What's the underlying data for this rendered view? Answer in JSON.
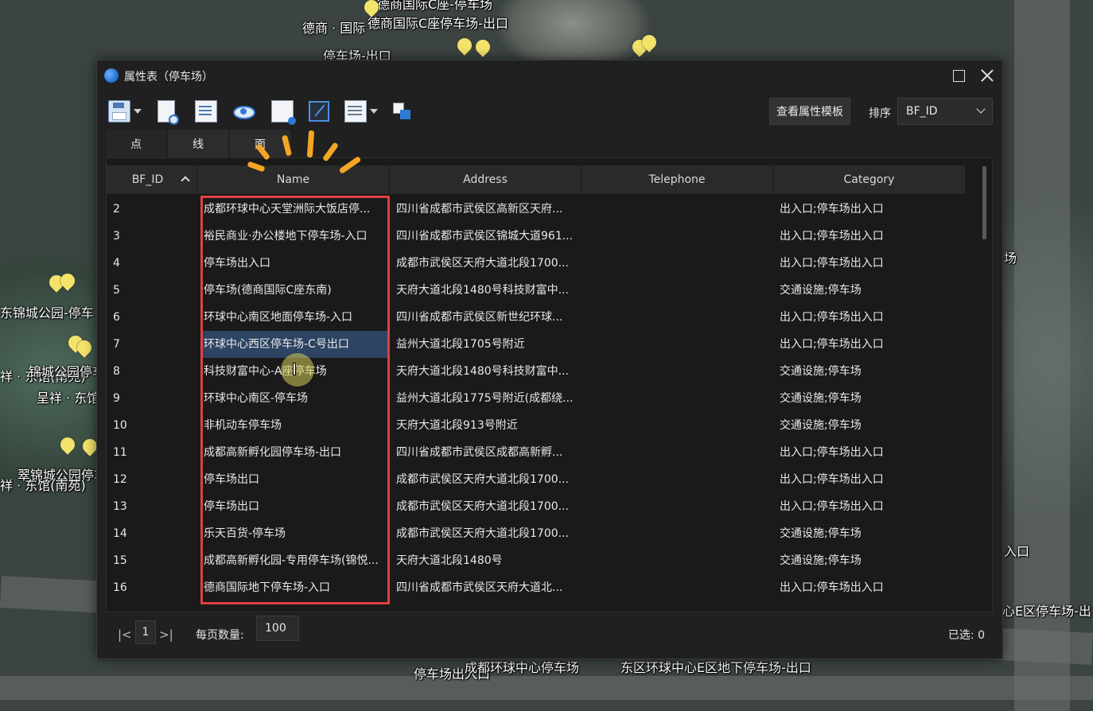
{
  "window": {
    "title": "属性表（停车场）"
  },
  "toolbar": {
    "view_template_label": "查看属性模板",
    "sort_label": "排序",
    "sort_value": "BF_ID"
  },
  "tabs": [
    {
      "label": "点"
    },
    {
      "label": "线"
    },
    {
      "label": "面"
    }
  ],
  "columns": [
    "BF_ID",
    "Name",
    "Address",
    "Telephone",
    "Category"
  ],
  "rows": [
    {
      "id": "2",
      "name": "成都环球中心天堂洲际大饭店停...",
      "address": "四川省成都市武侯区高新区天府...",
      "telephone": "",
      "category": "出入口;停车场出入口"
    },
    {
      "id": "3",
      "name": "裕民商业·办公楼地下停车场-入口",
      "address": "四川省成都市武侯区锦城大道961...",
      "telephone": "",
      "category": "出入口;停车场出入口"
    },
    {
      "id": "4",
      "name": "停车场出入口",
      "address": "成都市武侯区天府大道北段1700...",
      "telephone": "",
      "category": "出入口;停车场出入口"
    },
    {
      "id": "5",
      "name": "停车场(德商国际C座东南)",
      "address": "天府大道北段1480号科技财富中...",
      "telephone": "",
      "category": "交通设施;停车场"
    },
    {
      "id": "6",
      "name": "环球中心南区地面停车场-入口",
      "address": "四川省成都市武侯区新世纪环球...",
      "telephone": "",
      "category": "出入口;停车场出入口"
    },
    {
      "id": "7",
      "name": "环球中心西区停车场-C号出口",
      "address": "益州大道北段1705号附近",
      "telephone": "",
      "category": "出入口;停车场出入口"
    },
    {
      "id": "8",
      "name": "科技财富中心-A座停车场",
      "address": "天府大道北段1480号科技财富中...",
      "telephone": "",
      "category": "交通设施;停车场"
    },
    {
      "id": "9",
      "name": "环球中心南区-停车场",
      "address": "益州大道北段1775号附近(成都绕...",
      "telephone": "",
      "category": "交通设施;停车场"
    },
    {
      "id": "10",
      "name": "非机动车停车场",
      "address": "天府大道北段913号附近",
      "telephone": "",
      "category": "交通设施;停车场"
    },
    {
      "id": "11",
      "name": "成都高新孵化园停车场-出口",
      "address": "四川省成都市武侯区成都高新孵...",
      "telephone": "",
      "category": "出入口;停车场出入口"
    },
    {
      "id": "12",
      "name": "停车场出口",
      "address": "成都市武侯区天府大道北段1700...",
      "telephone": "",
      "category": "出入口;停车场出入口"
    },
    {
      "id": "13",
      "name": "停车场出口",
      "address": "成都市武侯区天府大道北段1700...",
      "telephone": "",
      "category": "出入口;停车场出入口"
    },
    {
      "id": "14",
      "name": "乐天百货-停车场",
      "address": "成都市武侯区天府大道北段1700...",
      "telephone": "",
      "category": "交通设施;停车场"
    },
    {
      "id": "15",
      "name": "成都高新孵化园-专用停车场(锦悦...",
      "address": "天府大道北段1480号",
      "telephone": "",
      "category": "交通设施;停车场"
    },
    {
      "id": "16",
      "name": "德商国际地下停车场-入口",
      "address": "四川省成都市武侯区天府大道北...",
      "telephone": "",
      "category": "出入口;停车场出入口"
    }
  ],
  "footer": {
    "first_glyph": "|<",
    "page": "1",
    "last_glyph": ">|",
    "per_page_label": "每页数量:",
    "per_page_value": "100",
    "selected_text": "已选: 0"
  },
  "map_labels": [
    "德商国际C座-停车场",
    "德商 · 国际",
    "德商国际C座停车场-出口",
    "停车场-出口",
    "东锦城公园-停车",
    "祥 · 东馆(南苑)",
    "锦城公园停车",
    "呈祥 · 东馆",
    "翠锦城公园停车",
    "祥 · 东馆(南苑)",
    "场",
    "入口",
    "心E区停车场-出",
    "停车场出入口",
    "成都环球中心停车场",
    "东区环球中心E区地下停车场-出口"
  ],
  "colors": {
    "highlight": "#e04040",
    "selection": "#2d4462",
    "burst": "#f4a623",
    "pin": "#f3e36a"
  }
}
